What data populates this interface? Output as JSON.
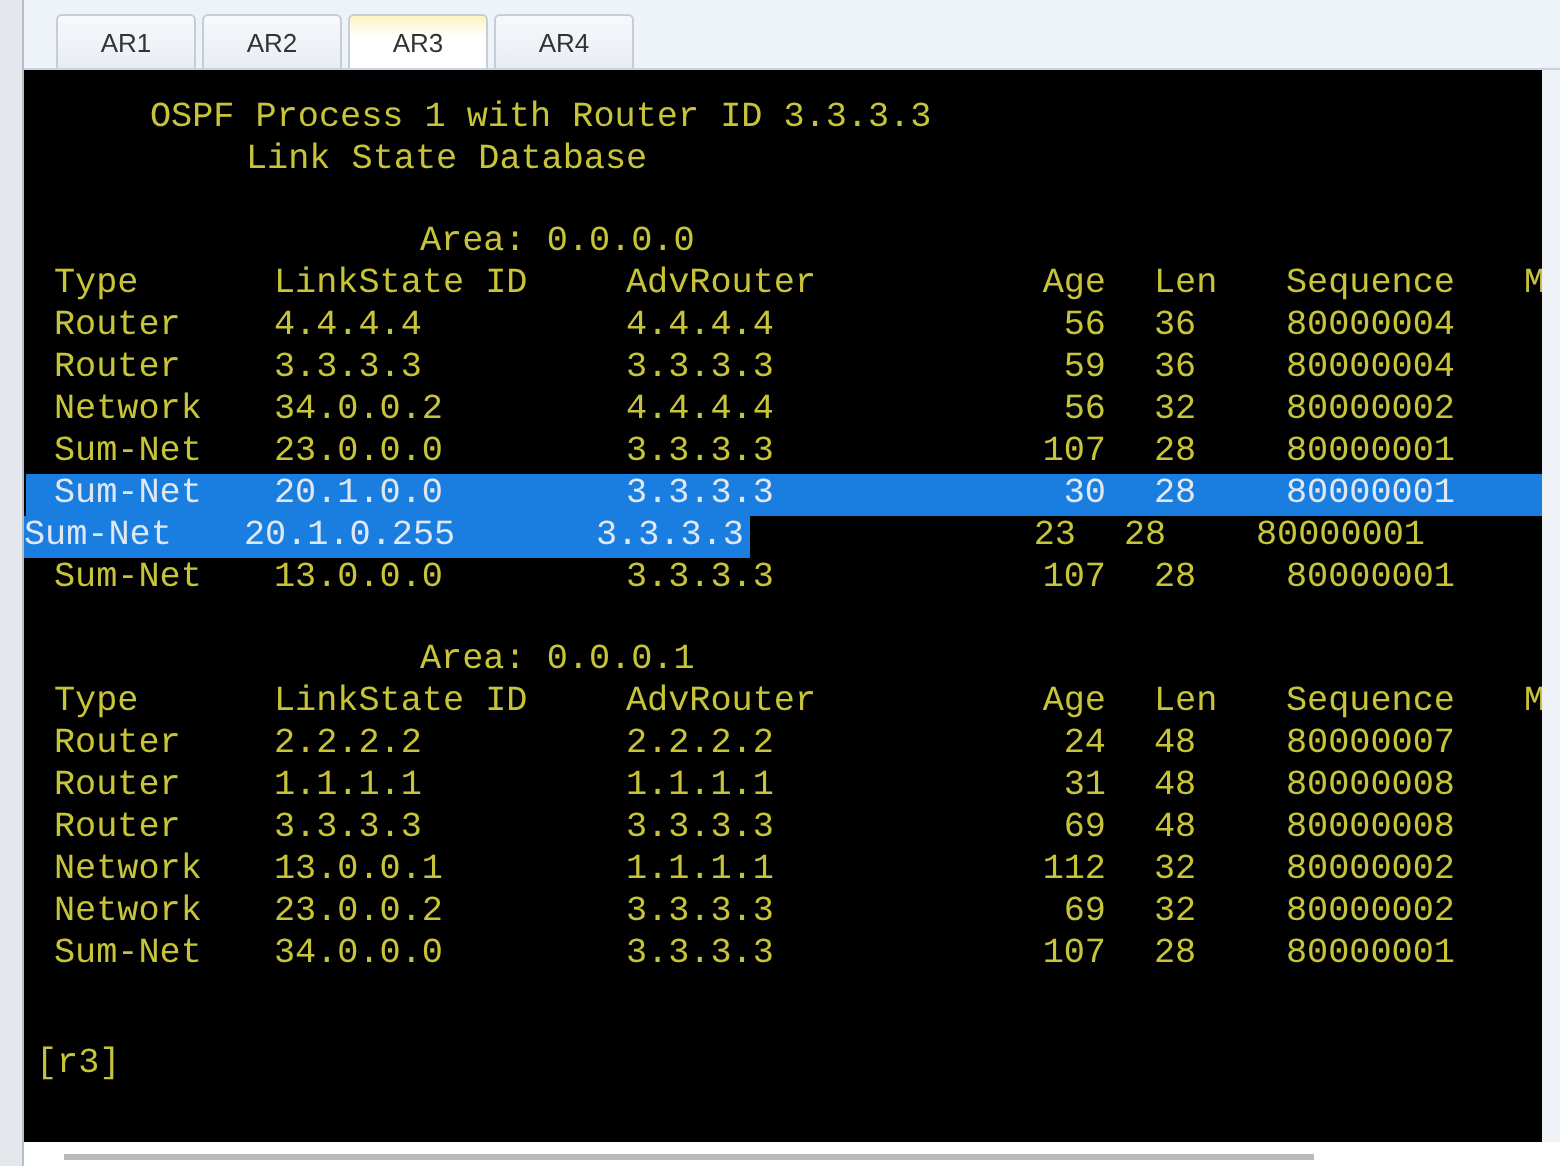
{
  "tabs": [
    {
      "label": "AR1",
      "selected": false
    },
    {
      "label": "AR2",
      "selected": false
    },
    {
      "label": "AR3",
      "selected": true
    },
    {
      "label": "AR4",
      "selected": false
    }
  ],
  "terminal": {
    "title_lines": [
      "OSPF Process 1 with Router ID 3.3.3.3",
      "Link State Database"
    ],
    "areas": [
      {
        "label": "Area: 0.0.0.0",
        "columns": [
          "Type",
          "LinkState ID",
          "AdvRouter",
          "Age",
          "Len",
          "Sequence",
          "M"
        ],
        "rows": [
          {
            "cells": [
              "Router",
              "4.4.4.4",
              "4.4.4.4",
              "56",
              "36",
              "80000004"
            ],
            "selected": false
          },
          {
            "cells": [
              "Router",
              "3.3.3.3",
              "3.3.3.3",
              "59",
              "36",
              "80000004"
            ],
            "selected": false
          },
          {
            "cells": [
              "Network",
              "34.0.0.2",
              "4.4.4.4",
              "56",
              "32",
              "80000002"
            ],
            "selected": false
          },
          {
            "cells": [
              "Sum-Net",
              "23.0.0.0",
              "3.3.3.3",
              "107",
              "28",
              "80000001"
            ],
            "selected": false
          },
          {
            "cells": [
              "Sum-Net",
              "20.1.0.0",
              "3.3.3.3",
              "30",
              "28",
              "80000001"
            ],
            "selected": true
          },
          {
            "cells": [
              "Sum-Net",
              "20.1.0.255",
              "3.3.3.3",
              "23",
              "28",
              "80000001"
            ],
            "selected": true
          },
          {
            "cells": [
              "Sum-Net",
              "13.0.0.0",
              "3.3.3.3",
              "107",
              "28",
              "80000001"
            ],
            "selected": false
          }
        ]
      },
      {
        "label": "Area: 0.0.0.1",
        "columns": [
          "Type",
          "LinkState ID",
          "AdvRouter",
          "Age",
          "Len",
          "Sequence",
          "M"
        ],
        "rows": [
          {
            "cells": [
              "Router",
              "2.2.2.2",
              "2.2.2.2",
              "24",
              "48",
              "80000007"
            ],
            "selected": false
          },
          {
            "cells": [
              "Router",
              "1.1.1.1",
              "1.1.1.1",
              "31",
              "48",
              "80000008"
            ],
            "selected": false
          },
          {
            "cells": [
              "Router",
              "3.3.3.3",
              "3.3.3.3",
              "69",
              "48",
              "80000008"
            ],
            "selected": false
          },
          {
            "cells": [
              "Network",
              "13.0.0.1",
              "1.1.1.1",
              "112",
              "32",
              "80000002"
            ],
            "selected": false
          },
          {
            "cells": [
              "Network",
              "23.0.0.2",
              "3.3.3.3",
              "69",
              "32",
              "80000002"
            ],
            "selected": false
          },
          {
            "cells": [
              "Sum-Net",
              "34.0.0.0",
              "3.3.3.3",
              "107",
              "28",
              "80000001"
            ],
            "selected": false
          }
        ]
      }
    ],
    "prompt": "[r3]"
  }
}
